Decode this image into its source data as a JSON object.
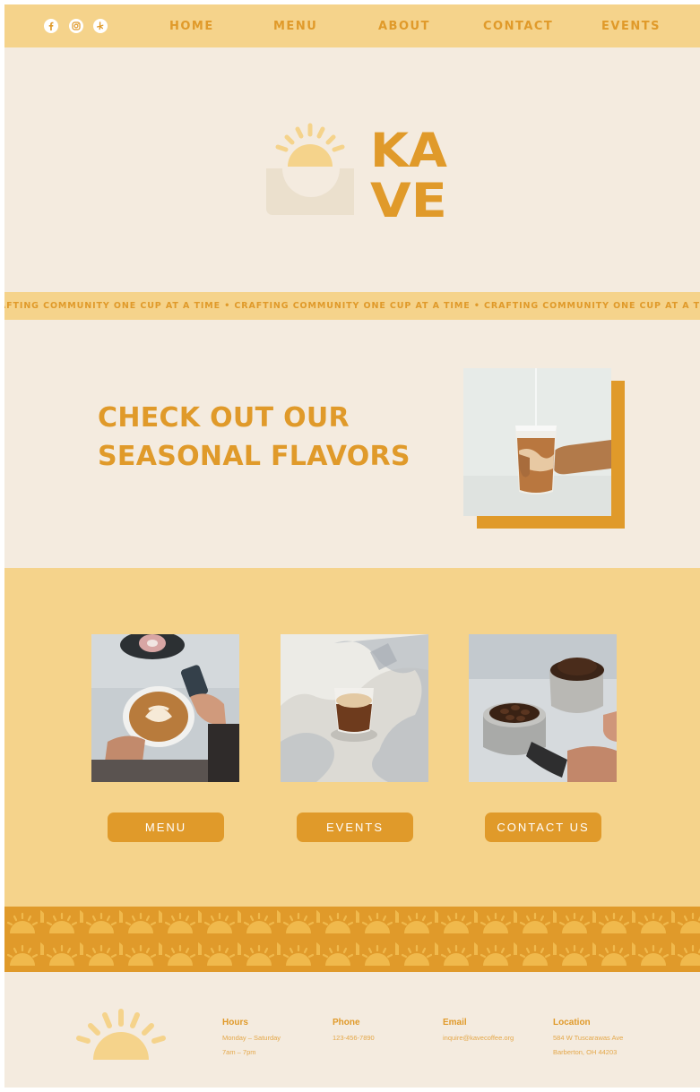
{
  "header": {
    "social": [
      {
        "icon": "facebook-icon"
      },
      {
        "icon": "instagram-icon"
      },
      {
        "icon": "yelp-icon"
      }
    ],
    "nav": [
      {
        "label": "HOME"
      },
      {
        "label": "MENU"
      },
      {
        "label": "ABOUT"
      },
      {
        "label": "CONTACT"
      },
      {
        "label": "EVENTS"
      }
    ]
  },
  "hero": {
    "brand_line1": "KA",
    "brand_line2": "VE",
    "icon": "sun-cup-icon"
  },
  "ticker": {
    "text": "CRAFTING COMMUNITY ONE CUP AT A TIME • CRAFTING COMMUNITY ONE CUP AT A TIME • CRAFTING COMMUNITY ONE CUP AT A TIME"
  },
  "seasonal": {
    "title_line1": "CHECK OUT OUR",
    "title_line2": "SEASONAL FLAVORS"
  },
  "links": {
    "buttons": [
      {
        "label": "MENU"
      },
      {
        "label": "EVENTS"
      },
      {
        "label": "CONTACT US"
      }
    ]
  },
  "footer": {
    "hours": {
      "heading": "Hours",
      "lines": [
        "Monday – Saturday",
        "7am – 7pm"
      ]
    },
    "phone": {
      "heading": "Phone",
      "lines": [
        "123-456-7890"
      ]
    },
    "email": {
      "heading": "Email",
      "lines": [
        "inquire@kavecoffee.org"
      ]
    },
    "location": {
      "heading": "Location",
      "lines": [
        "584 W Tuscarawas Ave",
        "Barberton, OH 44203"
      ]
    }
  },
  "colors": {
    "accent": "#e09a2a",
    "light_yellow": "#f5d38b",
    "cream": "#f4ebdf"
  }
}
